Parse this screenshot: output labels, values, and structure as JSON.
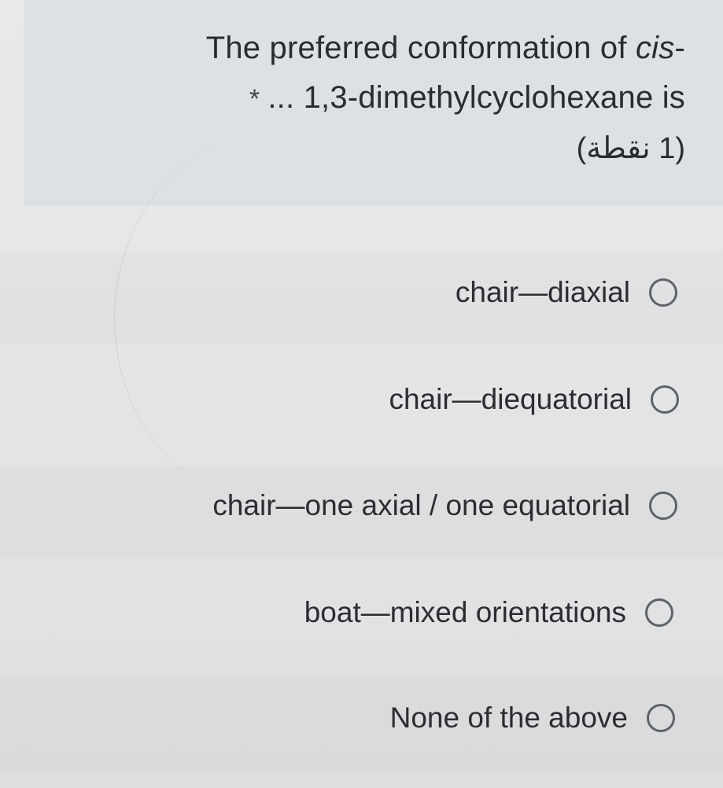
{
  "question": {
    "line1_prefix": "The preferred conformation of ",
    "line1_italic": "cis",
    "line1_suffix": "-",
    "required_marker": "*",
    "line2": "... 1,3-dimethylcyclohexane is",
    "points": "(1 نقطة)"
  },
  "options": [
    {
      "label": "chair—diaxial",
      "selected": false
    },
    {
      "label": "chair—diequatorial",
      "selected": false
    },
    {
      "label": "chair—one axial / one equatorial",
      "selected": false
    },
    {
      "label": "boat—mixed orientations",
      "selected": false
    },
    {
      "label": "None of the above",
      "selected": false
    }
  ],
  "colors": {
    "text": "#2b2d30",
    "radio_border": "#5f6368",
    "question_bg": "#dde1e4",
    "page_bg": "#e4e6e8"
  }
}
